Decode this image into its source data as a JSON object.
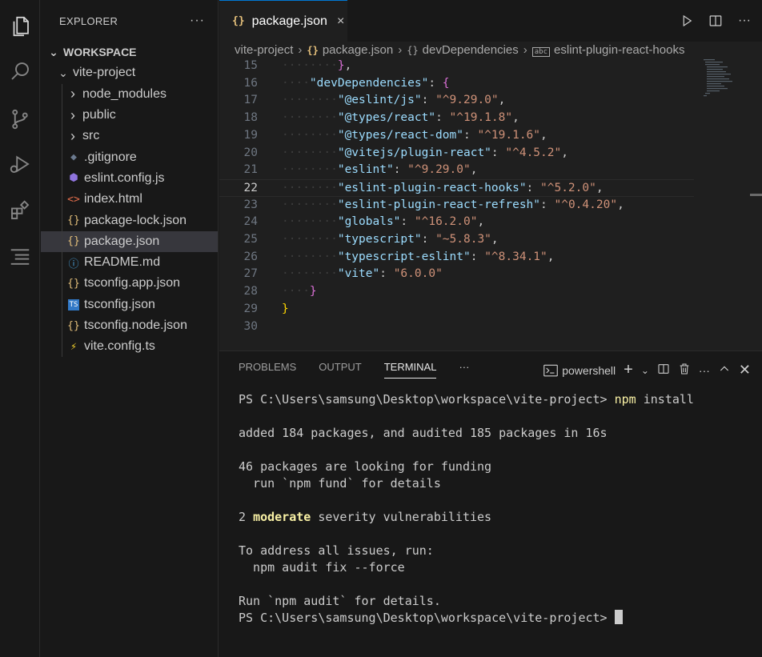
{
  "explorer": {
    "title": "EXPLORER",
    "more": "···",
    "workspace_label": "WORKSPACE",
    "project": "vite-project",
    "items": [
      {
        "label": "node_modules",
        "type": "folder",
        "icon": "chevron-right-icon"
      },
      {
        "label": "public",
        "type": "folder",
        "icon": "chevron-right-icon"
      },
      {
        "label": "src",
        "type": "folder",
        "icon": "chevron-right-icon"
      },
      {
        "label": ".gitignore",
        "type": "file",
        "icon": "git-icon",
        "color": "#6b7a8f",
        "glyph": "◆"
      },
      {
        "label": "eslint.config.js",
        "type": "file",
        "icon": "eslint-icon",
        "color": "#8f74dd",
        "glyph": "⬢"
      },
      {
        "label": "index.html",
        "type": "file",
        "icon": "html-icon",
        "color": "#e06c4b",
        "glyph": "<>"
      },
      {
        "label": "package-lock.json",
        "type": "file",
        "icon": "json-icon",
        "color": "#e5c07b",
        "glyph": "{}"
      },
      {
        "label": "package.json",
        "type": "file",
        "icon": "json-icon",
        "color": "#e5c07b",
        "glyph": "{}",
        "selected": true
      },
      {
        "label": "README.md",
        "type": "file",
        "icon": "info-icon",
        "color": "#4aa3df",
        "glyph": "ⓘ"
      },
      {
        "label": "tsconfig.app.json",
        "type": "file",
        "icon": "json-icon",
        "color": "#e5c07b",
        "glyph": "{}"
      },
      {
        "label": "tsconfig.json",
        "type": "file",
        "icon": "typescript-icon",
        "color": "#3178c6",
        "glyph": "TS"
      },
      {
        "label": "tsconfig.node.json",
        "type": "file",
        "icon": "json-icon",
        "color": "#e5c07b",
        "glyph": "{}"
      },
      {
        "label": "vite.config.ts",
        "type": "file",
        "icon": "vite-icon",
        "color": "#f5d22b",
        "glyph": "⚡"
      }
    ]
  },
  "editor": {
    "tab": {
      "label": "package.json",
      "icon_glyph": "{}",
      "close": "×"
    },
    "breadcrumb": [
      {
        "label": "vite-project",
        "glyph": ""
      },
      {
        "label": "package.json",
        "glyph": "{}"
      },
      {
        "label": "devDependencies",
        "glyph": "{}"
      },
      {
        "label": "eslint-plugin-react-hooks",
        "glyph": "abc"
      }
    ],
    "current_line": 22,
    "lines": [
      {
        "n": 15,
        "indent": 2,
        "key": "",
        "value": "",
        "text": "},",
        "brace": "b1"
      },
      {
        "n": 16,
        "indent": 1,
        "key": "\"devDependencies\"",
        "value": "",
        "open": "{",
        "brace": "b1"
      },
      {
        "n": 17,
        "indent": 2,
        "key": "\"@eslint/js\"",
        "value": "\"^9.29.0\","
      },
      {
        "n": 18,
        "indent": 2,
        "key": "\"@types/react\"",
        "value": "\"^19.1.8\","
      },
      {
        "n": 19,
        "indent": 2,
        "key": "\"@types/react-dom\"",
        "value": "\"^19.1.6\","
      },
      {
        "n": 20,
        "indent": 2,
        "key": "\"@vitejs/plugin-react\"",
        "value": "\"^4.5.2\","
      },
      {
        "n": 21,
        "indent": 2,
        "key": "\"eslint\"",
        "value": "\"^9.29.0\","
      },
      {
        "n": 22,
        "indent": 2,
        "key": "\"eslint-plugin-react-hooks\"",
        "value": "\"^5.2.0\","
      },
      {
        "n": 23,
        "indent": 2,
        "key": "\"eslint-plugin-react-refresh\"",
        "value": "\"^0.4.20\","
      },
      {
        "n": 24,
        "indent": 2,
        "key": "\"globals\"",
        "value": "\"^16.2.0\","
      },
      {
        "n": 25,
        "indent": 2,
        "key": "\"typescript\"",
        "value": "\"~5.8.3\","
      },
      {
        "n": 26,
        "indent": 2,
        "key": "\"typescript-eslint\"",
        "value": "\"^8.34.1\","
      },
      {
        "n": 27,
        "indent": 2,
        "key": "\"vite\"",
        "value": "\"6.0.0\""
      },
      {
        "n": 28,
        "indent": 1,
        "key": "",
        "value": "",
        "text": "}",
        "brace": "b1"
      },
      {
        "n": 29,
        "indent": 0,
        "key": "",
        "value": "",
        "text": "}",
        "brace": "b0"
      },
      {
        "n": 30,
        "indent": 0,
        "key": "",
        "value": "",
        "text": ""
      }
    ]
  },
  "panel": {
    "tabs": [
      {
        "label": "PROBLEMS",
        "active": false
      },
      {
        "label": "OUTPUT",
        "active": false
      },
      {
        "label": "TERMINAL",
        "active": true
      }
    ],
    "more": "···",
    "shell": "powershell",
    "terminal_lines": [
      {
        "prompt": "PS C:\\Users\\samsung\\Desktop\\workspace\\vite-project> ",
        "cmd": "npm install"
      },
      {
        "text": ""
      },
      {
        "text": "added 184 packages, and audited 185 packages in 16s"
      },
      {
        "text": ""
      },
      {
        "text": "46 packages are looking for funding"
      },
      {
        "text": "  run `npm fund` for details"
      },
      {
        "text": ""
      },
      {
        "pre": "2 ",
        "bold": "moderate",
        "post": " severity vulnerabilities"
      },
      {
        "text": ""
      },
      {
        "text": "To address all issues, run:"
      },
      {
        "text": "  npm audit fix --force"
      },
      {
        "text": ""
      },
      {
        "text": "Run `npm audit` for details."
      },
      {
        "prompt": "PS C:\\Users\\samsung\\Desktop\\workspace\\vite-project> ",
        "cursor": true
      }
    ]
  },
  "colors": {
    "accent": "#0078d4",
    "json_icon": "#e5c07b",
    "string": "#ce9178",
    "key": "#9cdcfe"
  }
}
